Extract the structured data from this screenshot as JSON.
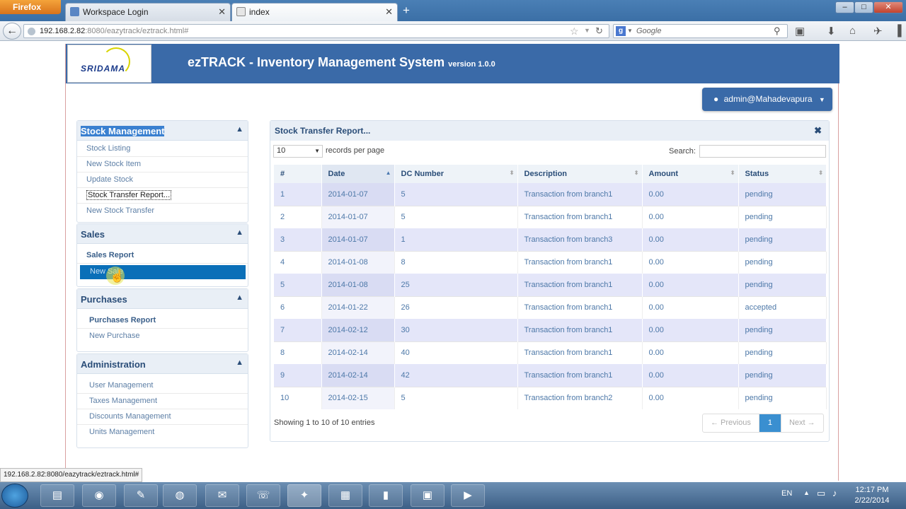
{
  "browser": {
    "menu_button": "Firefox",
    "tabs": [
      {
        "label": "Workspace Login"
      },
      {
        "label": "index"
      }
    ],
    "new_tab_label": "+",
    "window_controls": [
      "–",
      "□",
      "✕"
    ],
    "url_host": "192.168.2.82",
    "url_rest": ":8080/eazytrack/eztrack.html#",
    "search_placeholder": "Google",
    "status_link": "192.168.2.82:8080/eazytrack/eztrack.html#"
  },
  "header": {
    "logo_text": "SRIDAMA",
    "title": "ezTRACK - Inventory Management System",
    "version": "version 1.0.0",
    "user_label": "admin@Mahadevapura"
  },
  "sidebar": {
    "sections": [
      {
        "title": "Stock Management",
        "items": [
          "Stock Listing",
          "New Stock Item",
          "Update Stock",
          "Stock Transfer Report...",
          "New Stock Transfer"
        ]
      },
      {
        "title": "Sales",
        "items": [
          "Sales Report",
          "New Sale"
        ]
      },
      {
        "title": "Purchases",
        "items": [
          "Purchases Report",
          "New Purchase"
        ]
      },
      {
        "title": "Administration",
        "items": [
          "User Management",
          "Taxes Management",
          "Discounts Management",
          "Units Management"
        ]
      }
    ]
  },
  "report": {
    "title": "Stock Transfer Report...",
    "page_length": "10",
    "length_label": "records per page",
    "search_label": "Search:",
    "columns": [
      "#",
      "Date",
      "DC Number",
      "Description",
      "Amount",
      "Status"
    ],
    "rows": [
      [
        "1",
        "2014-01-07",
        "5",
        "Transaction from branch1",
        "0.00",
        "pending"
      ],
      [
        "2",
        "2014-01-07",
        "5",
        "Transaction from branch1",
        "0.00",
        "pending"
      ],
      [
        "3",
        "2014-01-07",
        "1",
        "Transaction from branch3",
        "0.00",
        "pending"
      ],
      [
        "4",
        "2014-01-08",
        "8",
        "Transaction from branch1",
        "0.00",
        "pending"
      ],
      [
        "5",
        "2014-01-08",
        "25",
        "Transaction from branch1",
        "0.00",
        "pending"
      ],
      [
        "6",
        "2014-01-22",
        "26",
        "Transaction from branch1",
        "0.00",
        "accepted"
      ],
      [
        "7",
        "2014-02-12",
        "30",
        "Transaction from branch1",
        "0.00",
        "pending"
      ],
      [
        "8",
        "2014-02-14",
        "40",
        "Transaction from branch1",
        "0.00",
        "pending"
      ],
      [
        "9",
        "2014-02-14",
        "42",
        "Transaction from branch1",
        "0.00",
        "pending"
      ],
      [
        "10",
        "2014-02-15",
        "5",
        "Transaction from branch2",
        "0.00",
        "pending"
      ]
    ],
    "info": "Showing 1 to 10 of 10 entries",
    "pager": {
      "prev": "← Previous",
      "current": "1",
      "next": "Next →"
    }
  },
  "taskbar": {
    "lang": "EN",
    "time": "12:17 PM",
    "date": "2/22/2014"
  },
  "colors": {
    "brand": "#3a6aa8",
    "active_item": "#0a6fb8"
  }
}
